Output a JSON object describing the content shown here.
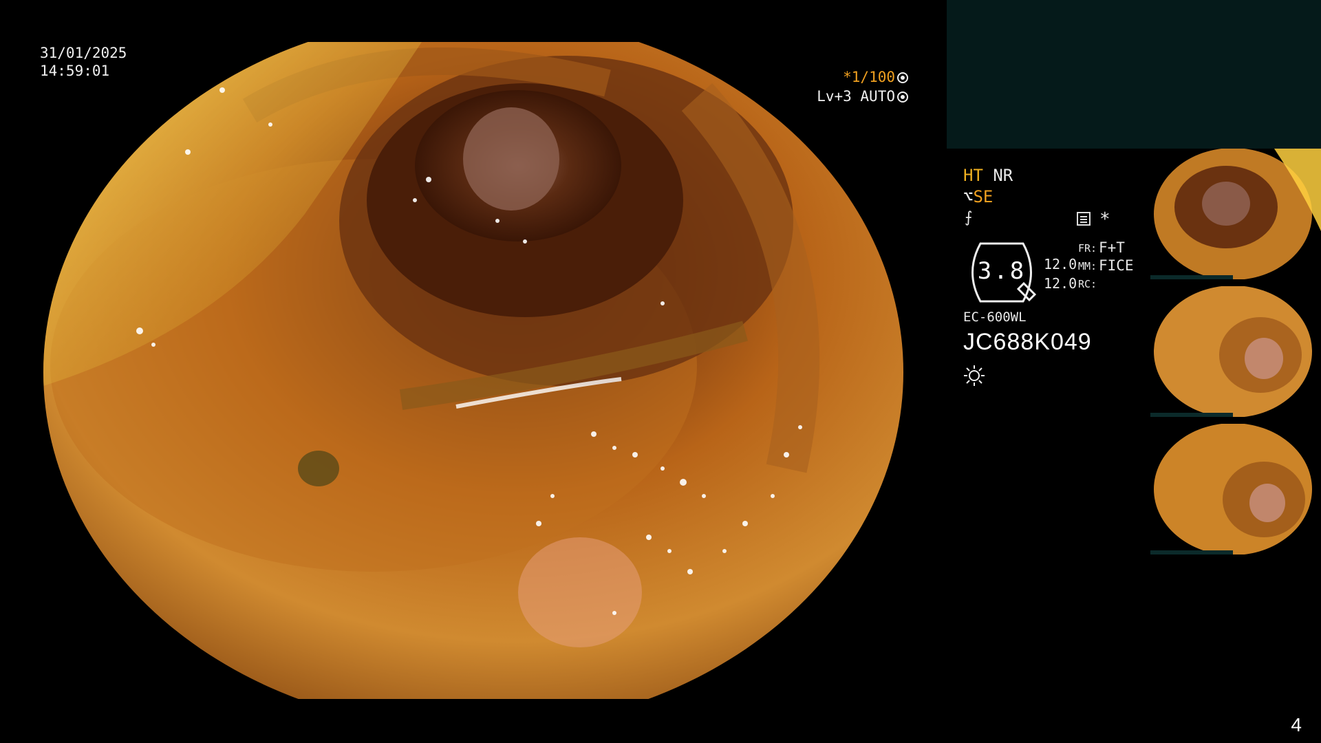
{
  "osd": {
    "date": "31/01/2025",
    "time": "14:59:01",
    "shutter": "*1/100",
    "level": "Lv+3 AUTO"
  },
  "modes": {
    "ht": "HT",
    "nr": "NR",
    "se": "SE",
    "asterisk": "*"
  },
  "zoom": {
    "value": "3.8",
    "num1": "12.0",
    "num2": "12.0",
    "fr_label": "FR:",
    "fr_value": "F+T",
    "mm_label": "MM:",
    "mm_value": "FICE",
    "rc_label": "RC:"
  },
  "scope": {
    "model": "EC-600WL",
    "serial": "JC688K049"
  },
  "page_number": "4",
  "colors": {
    "accent": "#f0a020",
    "panel": "#051a1a"
  },
  "icons": [
    "shutter-icon",
    "auto-icon",
    "curve-icon",
    "settings-icon",
    "light-icon"
  ]
}
